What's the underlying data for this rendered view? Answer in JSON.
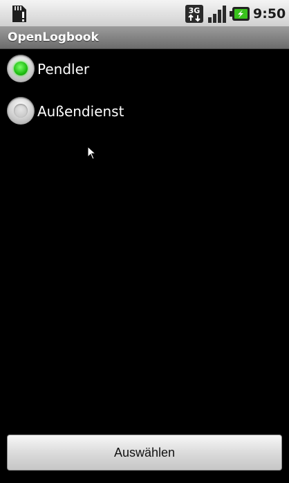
{
  "statusbar": {
    "time": "9:50",
    "net_label": "3G",
    "icons": [
      "sd-card-icon",
      "network-3g-icon",
      "signal-icon",
      "battery-charging-icon"
    ]
  },
  "app": {
    "title": "OpenLogbook"
  },
  "options": [
    {
      "label": "Pendler",
      "checked": true
    },
    {
      "label": "Außendienst",
      "checked": false
    }
  ],
  "button": {
    "label": "Auswählen"
  },
  "colors": {
    "radio_checked": "#22cc11",
    "title_bar": "#8a8a8a",
    "background": "#000000"
  }
}
